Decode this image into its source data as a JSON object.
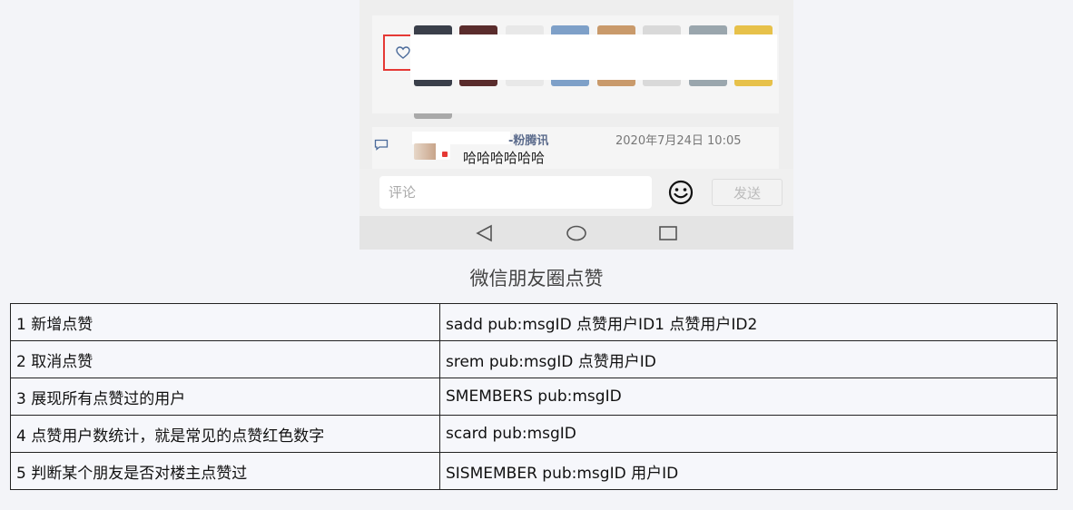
{
  "post": {
    "comment": {
      "author": "-粉腾讯",
      "timestamp": "2020年7月24日 10:05",
      "text": "哈哈哈哈哈哈"
    },
    "avatar_colors": [
      "#3a3f4a",
      "#5a2c2c",
      "#e8e8e8",
      "#7ea0c8",
      "#c99a6b",
      "#d9d9d9",
      "#9aa6ad",
      "#e7c14a"
    ]
  },
  "input_bar": {
    "placeholder": "评论",
    "send_label": "发送",
    "emoji_icon": "smiley-icon"
  },
  "nav": {
    "back_icon": "triangle-back-icon",
    "home_icon": "circle-home-icon",
    "recents_icon": "square-recents-icon"
  },
  "caption": "微信朋友圈点赞",
  "table": {
    "rows": [
      [
        "1 新增点赞",
        "sadd pub:msgID  点赞用户ID1  点赞用户ID2"
      ],
      [
        "2 取消点赞",
        "srem pub:msgID  点赞用户ID"
      ],
      [
        "3 展现所有点赞过的用户",
        "SMEMBERS  pub:msgID"
      ],
      [
        "4 点赞用户数统计，就是常见的点赞红色数字",
        "scard  pub:msgID"
      ],
      [
        "5 判断某个朋友是否对楼主点赞过",
        "SISMEMBER pub:msgID 用户ID"
      ]
    ]
  },
  "colors": {
    "highlight_border": "#e53935",
    "link_name": "#5b6b8c"
  }
}
